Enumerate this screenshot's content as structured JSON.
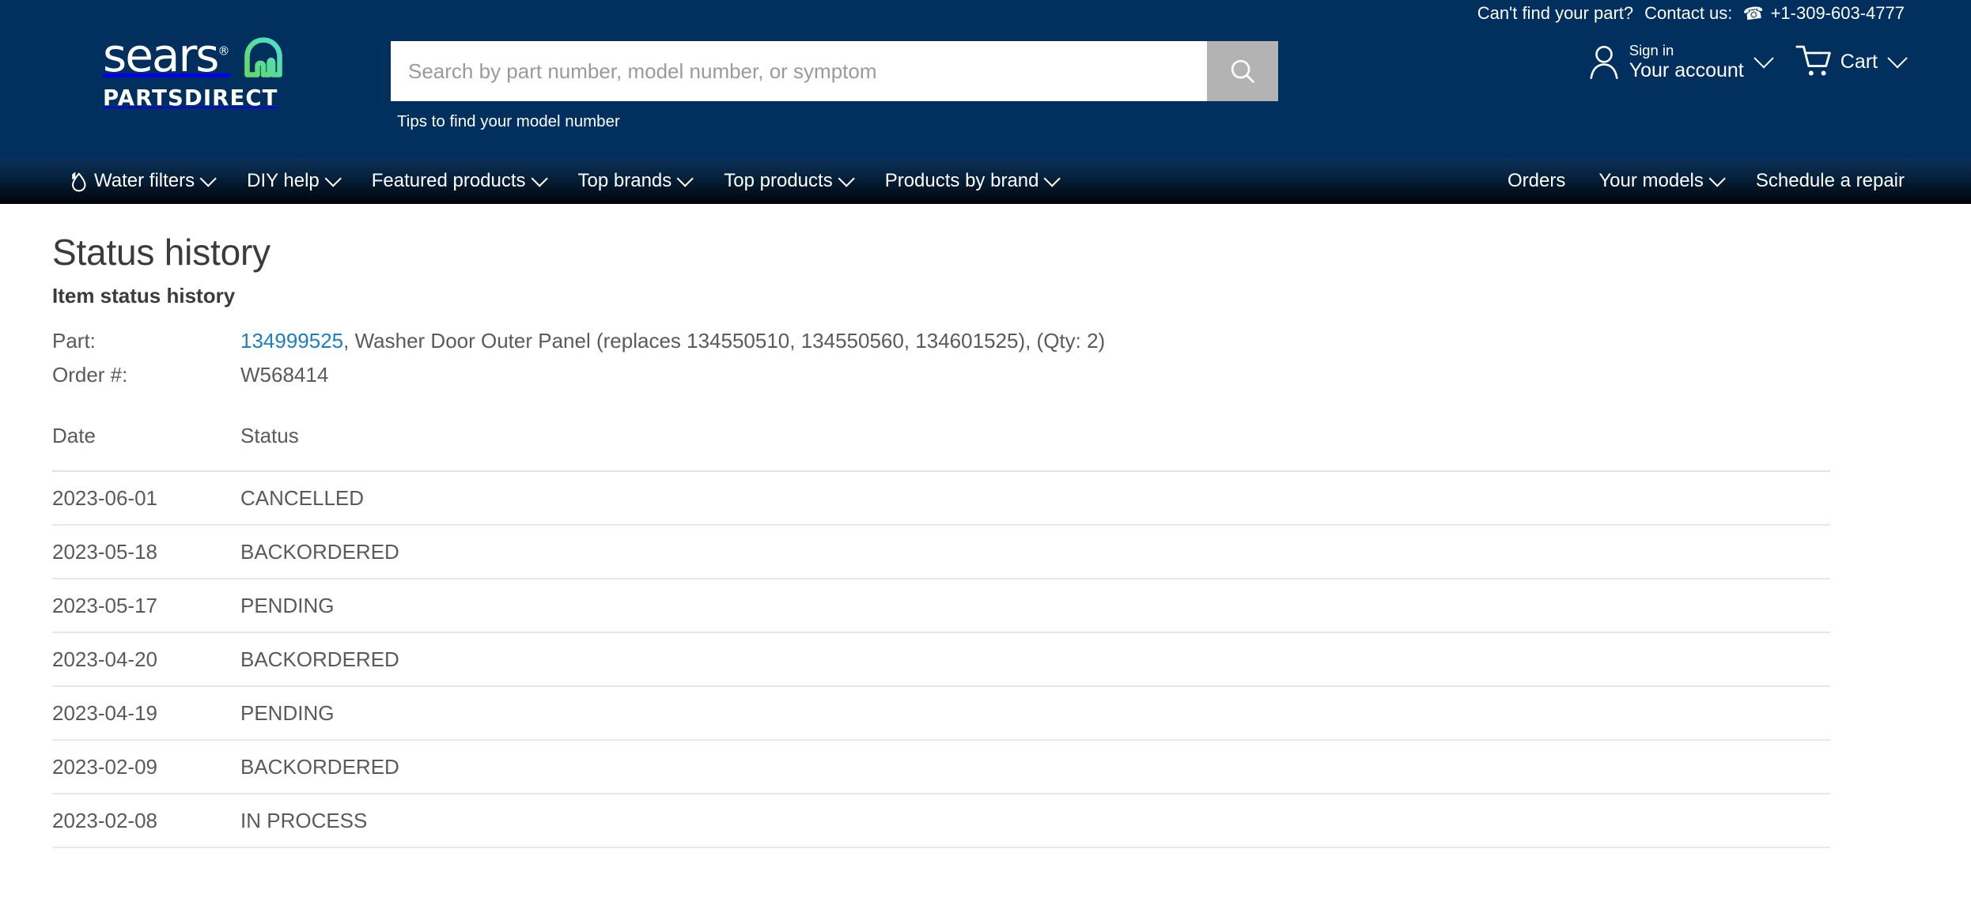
{
  "header": {
    "utility": {
      "cant_find": "Can't find your part?",
      "contact_label": "Contact us:",
      "phone": "+1-309-603-4777",
      "phone_icon": "phone-icon"
    },
    "logo": {
      "wordmark": "sears",
      "registered": "®",
      "subtext": "PARTSDIRECT",
      "mark_icon": "sears-home-arch-icon",
      "gradient_from": "#4ce0cf",
      "gradient_to": "#63d966"
    },
    "search": {
      "placeholder": "Search by part number, model number, or symptom",
      "value": "",
      "button_icon": "search-icon",
      "tips_link": "Tips to find your model number"
    },
    "account": {
      "icon": "user-icon",
      "line1": "Sign in",
      "line2": "Your account",
      "chevron_icon": "chevron-down-icon"
    },
    "cart": {
      "icon": "cart-icon",
      "label": "Cart",
      "chevron_icon": "chevron-down-icon"
    },
    "background_color": "#012f5e"
  },
  "nav": {
    "left_items": [
      {
        "label": "Water filters",
        "icon": "water-drop-icon",
        "has_chevron": true
      },
      {
        "label": "DIY help",
        "icon": "",
        "has_chevron": true
      },
      {
        "label": "Featured products",
        "icon": "",
        "has_chevron": true
      },
      {
        "label": "Top brands",
        "icon": "",
        "has_chevron": true
      },
      {
        "label": "Top products",
        "icon": "",
        "has_chevron": true
      },
      {
        "label": "Products by brand",
        "icon": "",
        "has_chevron": true
      }
    ],
    "right_items": [
      {
        "label": "Orders",
        "has_chevron": false
      },
      {
        "label": "Your models",
        "has_chevron": true
      },
      {
        "label": "Schedule a repair",
        "has_chevron": false
      }
    ]
  },
  "main": {
    "page_title": "Status history",
    "section_title": "Item status history",
    "meta": {
      "part_label": "Part:",
      "part_number": "134999525",
      "part_description": ", Washer Door Outer Panel (replaces 134550510, 134550560, 134601525), (Qty: 2)",
      "order_label": "Order #:",
      "order_number": "W568414"
    },
    "table": {
      "columns": [
        "Date",
        "Status"
      ],
      "rows": [
        {
          "date": "2023-06-01",
          "status": "CANCELLED"
        },
        {
          "date": "2023-05-18",
          "status": "BACKORDERED"
        },
        {
          "date": "2023-05-17",
          "status": "PENDING"
        },
        {
          "date": "2023-04-20",
          "status": "BACKORDERED"
        },
        {
          "date": "2023-04-19",
          "status": "PENDING"
        },
        {
          "date": "2023-02-09",
          "status": "BACKORDERED"
        },
        {
          "date": "2023-02-08",
          "status": "IN PROCESS"
        }
      ]
    }
  },
  "colors": {
    "header_navy": "#012f5e",
    "link_blue": "#1b7fc4",
    "body_text": "#5a5a5a",
    "title_text": "#3b3b3b",
    "row_divider": "#e8e8e8"
  }
}
